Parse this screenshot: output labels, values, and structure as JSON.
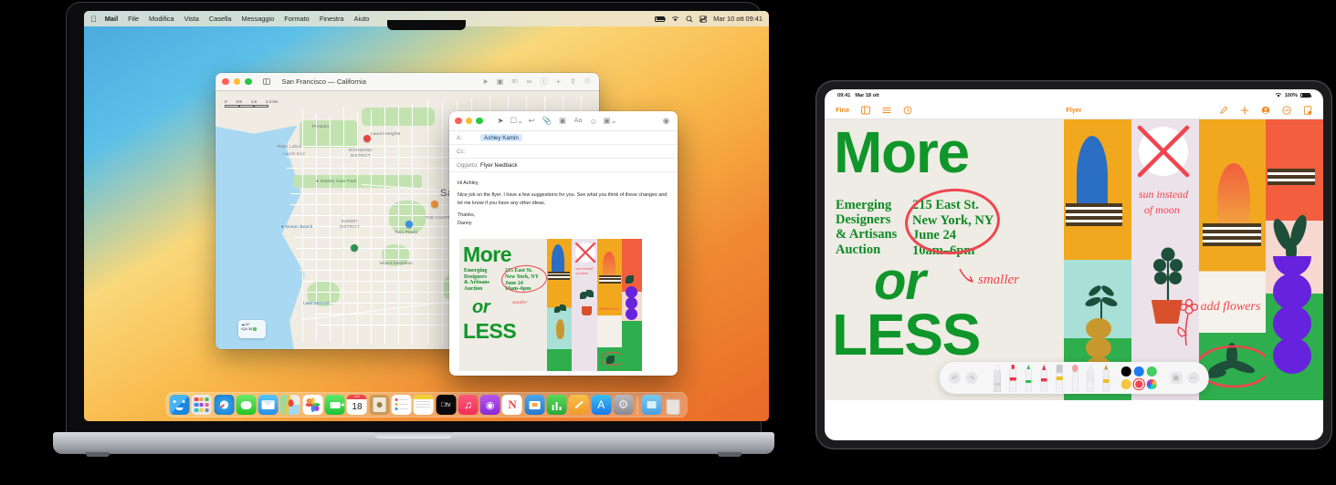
{
  "macos": {
    "menubar": {
      "apple_icon": "apple-logo-icon",
      "items": [
        {
          "label": "Mail",
          "bold": true
        },
        {
          "label": "File"
        },
        {
          "label": "Modifica"
        },
        {
          "label": "Vista"
        },
        {
          "label": "Casella"
        },
        {
          "label": "Messaggio"
        },
        {
          "label": "Formato"
        },
        {
          "label": "Finestra"
        },
        {
          "label": "Aiuto"
        }
      ],
      "status": {
        "battery_icon": "battery-icon",
        "wifi_icon": "wifi-icon",
        "search_icon": "search-icon",
        "control_center_icon": "control-center-icon",
        "clock": "Mar 10 ott 09:41"
      }
    },
    "maps_window": {
      "title": "San Francisco — California",
      "sidebar_icon": "sidebar-toggle-icon",
      "toolbar_icons": [
        "location-arrow-icon",
        "look-around-icon",
        "3d-icon",
        "share-icon",
        "info-icon",
        "zoom-in-icon",
        "upload-icon",
        "account-icon"
      ],
      "scale": {
        "ticks": [
          "0",
          "0.8",
          "1.6",
          "2.4 km"
        ]
      },
      "labels": [
        {
          "text": "San Francisco",
          "kind": "city"
        },
        {
          "text": "RICHMOND\nDISTRICT",
          "kind": "district"
        },
        {
          "text": "SUNSET\nDISTRICT",
          "kind": "district"
        },
        {
          "text": "Golden Gate Park",
          "kind": "park"
        },
        {
          "text": "Ocean Beach",
          "kind": "beach"
        },
        {
          "text": "Point Lobos",
          "kind": "point"
        },
        {
          "text": "Lands End",
          "kind": "point"
        },
        {
          "text": "THE CASTRO",
          "kind": "district"
        },
        {
          "text": "Twin Peaks",
          "kind": "point"
        },
        {
          "text": "Lake Merced",
          "kind": "point"
        },
        {
          "text": "Mount Davidson",
          "kind": "point"
        },
        {
          "text": "Laurel Heights",
          "kind": "point"
        },
        {
          "text": "Presidio",
          "kind": "point"
        }
      ],
      "weather_widget": {
        "temp": "14°",
        "aqi_label": "IQA 38"
      }
    },
    "mail_window": {
      "toolbar_icons": [
        "send-icon",
        "archive-dropdown-icon",
        "reply-icon",
        "attach-icon",
        "photo-browser-icon",
        "format-icon",
        "emoji-icon",
        "markup-dropdown-icon",
        "more-icon"
      ],
      "to_label": "A:",
      "to_value": "Ashley Kamin",
      "cc_label": "Cc:",
      "cc_value": "",
      "subject_label": "Oggetto:",
      "subject_value": "Flyer feedback",
      "body": [
        "Hi Ashley,",
        "Nice job on the flyer. I have a few suggestions for you. See what you think of these changes and let me know if you have any other ideas.",
        "Thanks,",
        "Danny"
      ]
    },
    "dock": {
      "items": [
        {
          "name": "finder",
          "label": "Finder"
        },
        {
          "name": "launchpad",
          "label": "Launchpad"
        },
        {
          "name": "safari",
          "label": "Safari"
        },
        {
          "name": "messages",
          "label": "Messaggi"
        },
        {
          "name": "mail",
          "label": "Mail"
        },
        {
          "name": "maps",
          "label": "Mappe"
        },
        {
          "name": "photos",
          "label": "Foto"
        },
        {
          "name": "facetime",
          "label": "FaceTime"
        },
        {
          "name": "calendar",
          "label": "18"
        },
        {
          "name": "contacts",
          "label": "Contatti"
        },
        {
          "name": "reminders",
          "label": "Promemoria"
        },
        {
          "name": "notes",
          "label": "Note"
        },
        {
          "name": "appletv",
          "label": "Apple TV"
        },
        {
          "name": "music",
          "label": "Musica"
        },
        {
          "name": "podcasts",
          "label": "Podcast"
        },
        {
          "name": "news",
          "label": "News"
        },
        {
          "name": "keynote",
          "label": "Keynote"
        },
        {
          "name": "numbers",
          "label": "Numbers"
        },
        {
          "name": "pages",
          "label": "Pages"
        },
        {
          "name": "appstore",
          "label": "App Store"
        },
        {
          "name": "settings",
          "label": "Impostazioni"
        },
        {
          "name": "downloads",
          "label": "Download"
        },
        {
          "name": "trash",
          "label": "Cestino"
        }
      ]
    }
  },
  "ipad": {
    "status": {
      "time": "09:41",
      "date": "Mar 18 ott",
      "wifi_icon": "wifi-icon",
      "battery_pct": "100%"
    },
    "toolbar": {
      "done_label": "Fine",
      "left_icons": [
        "page-view-icon",
        "list-view-icon",
        "history-icon"
      ],
      "doc_title": "Flyer",
      "right_icons": [
        "markup-icon",
        "add-icon",
        "share-collab-icon",
        "minus-icon",
        "document-options-icon"
      ]
    },
    "pencil_kit": {
      "undo_icon": "undo-icon",
      "redo_icon": "redo-icon",
      "tools": [
        {
          "name": "pen-tool",
          "color": "#d8d8dc"
        },
        {
          "name": "marker-tool",
          "color": "#e8354a"
        },
        {
          "name": "highlighter-tool",
          "color": "#2fbf4f"
        },
        {
          "name": "crayon-tool",
          "color": "#e8354a"
        },
        {
          "name": "eraser-tool",
          "color": "#f0c020"
        },
        {
          "name": "smudge-tool",
          "color": "#f2a0a4"
        },
        {
          "name": "pencil-tool",
          "color": "#c8c8cc"
        },
        {
          "name": "fountain-pen-tool",
          "color": "#f0c020"
        }
      ],
      "colors": [
        "#000000",
        "#1a7cf0",
        "#45cc62",
        "#f7c53c",
        "#f0454f",
        "rainbow"
      ],
      "add_icon": "add-color-icon",
      "more_icon": "more-options-icon"
    }
  },
  "flyer": {
    "headline_1": "More",
    "headline_2": "or",
    "headline_3": "LESS",
    "subtitle": "Emerging\nDesigners\n& Artisans\nAuction",
    "address": "215 East St.\nNew York, NY\nJune 24\n10am–6pm",
    "annotations": [
      {
        "text": "smaller",
        "name": "annotation-smaller"
      },
      {
        "text": "sun instead",
        "name": "annotation-sun-line1"
      },
      {
        "text": "of moon",
        "name": "annotation-sun-line2"
      },
      {
        "text": "add flowers",
        "name": "annotation-add-flowers"
      }
    ],
    "colors": {
      "green": "#10962a",
      "red_annotation": "#f0454f",
      "paper": "#eeece4",
      "orange": "#f2a81e",
      "blue": "#3d8ed8",
      "mint": "#a8e0d8",
      "grass": "#2fae4e",
      "purple": "#6622dd",
      "coral": "#f25e3e"
    }
  }
}
